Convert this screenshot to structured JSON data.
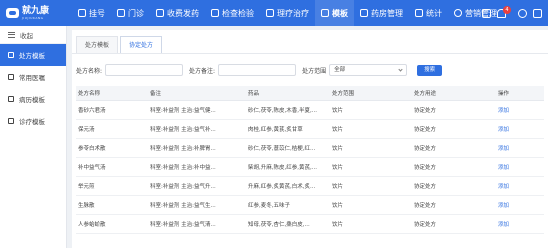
{
  "app": {
    "name": "就九康",
    "tagline": "JIUJIUKANG"
  },
  "nav": [
    {
      "label": "挂号",
      "active": false
    },
    {
      "label": "门诊",
      "active": false
    },
    {
      "label": "收费发药",
      "active": false
    },
    {
      "label": "检查检验",
      "active": false
    },
    {
      "label": "理疗治疗",
      "active": false
    },
    {
      "label": "模板",
      "active": true
    },
    {
      "label": "药房管理",
      "active": false
    },
    {
      "label": "统计",
      "active": false
    },
    {
      "label": "营销管理",
      "active": false
    }
  ],
  "header": {
    "badge_count": "4"
  },
  "sidebar": {
    "collapse_label": "收起",
    "items": [
      {
        "label": "处方模板",
        "active": true
      },
      {
        "label": "常用医嘱",
        "active": false
      },
      {
        "label": "病历模板",
        "active": false
      },
      {
        "label": "诊疗模板",
        "active": false
      }
    ]
  },
  "tabs": [
    {
      "label": "处方模板",
      "active": false
    },
    {
      "label": "协定处方",
      "active": true
    }
  ],
  "filters": {
    "name_label": "处方名称:",
    "note_label": "处方备注:",
    "scope_label": "处方范围",
    "scope_value": "全部",
    "search_label": "搜索"
  },
  "table": {
    "columns": [
      "处方名称",
      "备注",
      "药品",
      "处方范围",
      "处方用途",
      "操作"
    ],
    "rows": [
      [
        "香砂六君汤",
        "科室:补益剂 主治:益气健...",
        "砂仁,茯苓,陈皮,木香,半夏,...",
        "饮片",
        "协定处方",
        "添加"
      ],
      [
        "保元汤",
        "科室:补益剂 主治:益气补...",
        "肉桂,红参,黄芪,炙甘草",
        "饮片",
        "协定处方",
        "添加"
      ],
      [
        "参苓白术散",
        "科室:补益剂 主治:补脾胃...",
        "砂仁,茯苓,薏苡仁,桔梗,红...",
        "饮片",
        "协定处方",
        "添加"
      ],
      [
        "补中益气汤",
        "科室:补益剂 主治:补中益...",
        "柴胡,升麻,陈皮,红参,黄芪,...",
        "饮片",
        "协定处方",
        "添加"
      ],
      [
        "举元煎",
        "科室:补益剂 主治:益气升...",
        "升麻,红参,炙黄芪,白术,炙...",
        "饮片",
        "协定处方",
        "添加"
      ],
      [
        "生脉散",
        "科室:补益剂 主治:益气生...",
        "红参,麦冬,五味子",
        "饮片",
        "协定处方",
        "添加"
      ],
      [
        "人参蛤蚧散",
        "科室:补益剂 主治:益气清...",
        "知母,茯苓,杏仁,桑白皮,...",
        "饮片",
        "协定处方",
        "添加"
      ]
    ]
  },
  "colors": {
    "primary": "#2f6fe0",
    "badge": "#e94040"
  }
}
